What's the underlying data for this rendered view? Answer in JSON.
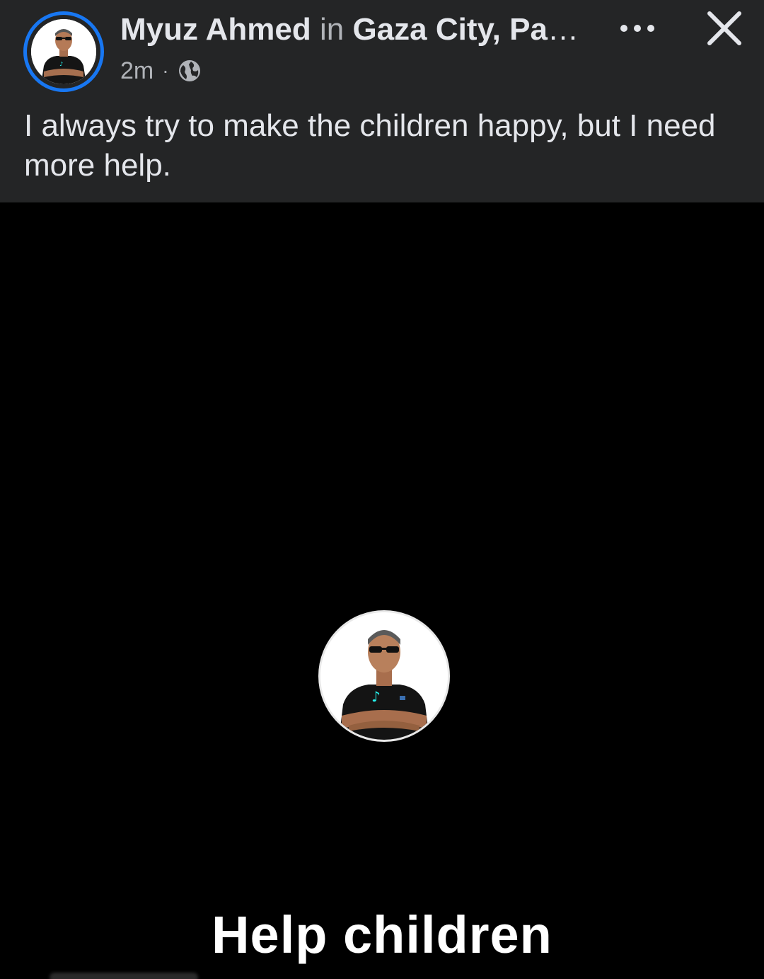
{
  "post": {
    "author": "Myuz Ahmed",
    "connector": "in",
    "location": "Gaza City, Pale...",
    "time": "2m",
    "separator": "·",
    "privacy_icon": "globe-icon",
    "more_icon": "more-options-icon",
    "close_icon": "close-icon",
    "text": "I always try to make the children happy, but I need more help."
  },
  "video": {
    "caption": "Help children",
    "avatar_icon": "profile-photo"
  },
  "colors": {
    "header_bg": "#242526",
    "primary_text": "#e4e6eb",
    "secondary_text": "#b0b3b8",
    "story_ring": "#1877f2",
    "video_bg": "#000000"
  }
}
